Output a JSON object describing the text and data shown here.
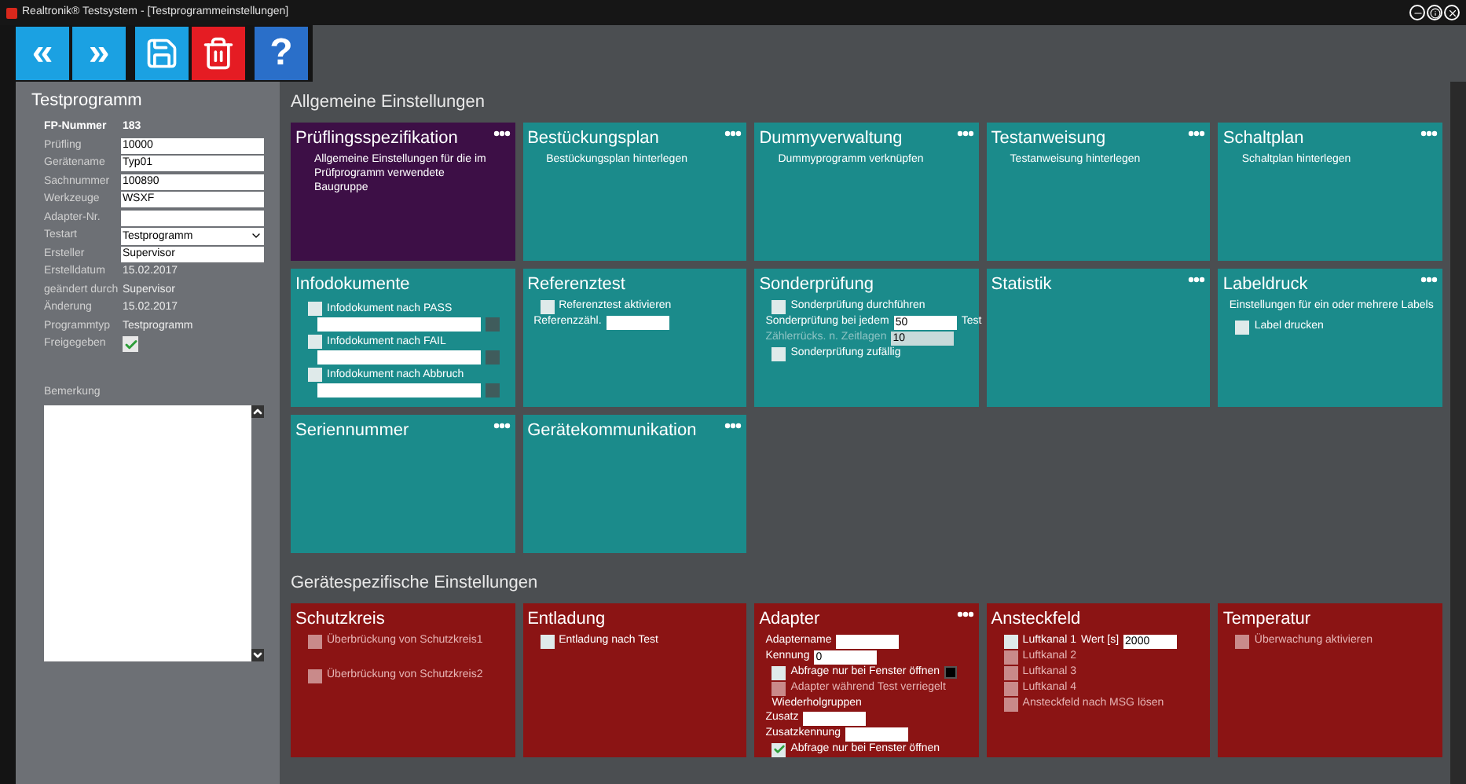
{
  "window": {
    "title": "Realtronik® Testsystem - [Testprogrammeinstellungen]"
  },
  "toolbar": [
    {
      "kind": "glyph",
      "label": "«",
      "color": "#1ba1e2"
    },
    {
      "kind": "glyph",
      "label": "»",
      "color": "#1ba1e2"
    },
    {
      "kind": "save",
      "color": "#1ba1e2"
    },
    {
      "kind": "delete",
      "color": "#e51c23"
    },
    {
      "kind": "glyph",
      "label": "?",
      "color": "#2a6fc9"
    }
  ],
  "left_panel": {
    "title": "Testprogramm",
    "rows": [
      {
        "kind": "static",
        "label": "FP-Nummer",
        "value": "183",
        "bold": true
      },
      {
        "kind": "input",
        "label": "Prüfling",
        "value": "10000"
      },
      {
        "kind": "input",
        "label": "Gerätename",
        "value": "Typ01"
      },
      {
        "kind": "input",
        "label": "Sachnummer",
        "value": "100890"
      },
      {
        "kind": "input",
        "label": "Werkzeuge",
        "value": "WSXF"
      },
      {
        "kind": "input",
        "label": "Adapter-Nr."
      },
      {
        "kind": "select",
        "label": "Testart",
        "value": "Testprogramm"
      },
      {
        "kind": "input",
        "label": "Ersteller",
        "value": "Supervisor"
      },
      {
        "kind": "static",
        "label": "Erstelldatum",
        "value": "15.02.2017"
      },
      {
        "kind": "static",
        "label": "geändert durch",
        "value": "Supervisor"
      },
      {
        "kind": "static",
        "label": "Änderung",
        "value": "15.02.2017"
      },
      {
        "kind": "static",
        "label": "Programmtyp",
        "value": "Testprogramm"
      },
      {
        "kind": "checkbox",
        "label": "Freigegeben",
        "checked": true
      }
    ],
    "remark_label": "Bemerkung"
  },
  "sections": [
    {
      "title": "Allgemeine Einstellungen",
      "tiles": [
        {
          "title": "Prüflingsspezifikation",
          "color": "#3d0f46",
          "menu": true,
          "items": [
            {
              "kind": "text",
              "text": "Allgemeine Einstellungen für die im Prüfprogramm verwendete Baugruppe"
            }
          ]
        },
        {
          "title": "Bestückungsplan",
          "color": "#1b8b8b",
          "menu": true,
          "items": [
            {
              "kind": "text",
              "text": "Bestückungsplan hinterlegen"
            }
          ]
        },
        {
          "title": "Dummyverwaltung",
          "color": "#1b8b8b",
          "menu": true,
          "items": [
            {
              "kind": "text",
              "text": "Dummyprogramm verknüpfen"
            }
          ]
        },
        {
          "title": "Testanweisung",
          "color": "#1b8b8b",
          "menu": true,
          "items": [
            {
              "kind": "text",
              "text": "Testanweisung hinterlegen"
            }
          ]
        },
        {
          "title": "Schaltplan",
          "color": "#1b8b8b",
          "menu": true,
          "items": [
            {
              "kind": "text",
              "text": "Schaltplan hinterlegen"
            }
          ]
        },
        {
          "title": "Infodokumente",
          "color": "#1b8b8b",
          "menu": false,
          "items": [
            {
              "kind": "doc",
              "label": "Infodokument nach PASS",
              "checked": false
            },
            {
              "kind": "doc",
              "label": "Infodokument nach FAIL",
              "checked": false
            },
            {
              "kind": "doc",
              "label": "Infodokument nach Abbruch",
              "checked": false
            }
          ]
        },
        {
          "title": "Referenztest",
          "color": "#1b8b8b",
          "menu": false,
          "items": [
            {
              "kind": "checkbox",
              "label": "Referenztest aktivieren",
              "checked": false,
              "disabled": false
            },
            {
              "kind": "field",
              "label": "Referenzzähl.",
              "disabled": false
            }
          ]
        },
        {
          "title": "Sonderprüfung",
          "color": "#1b8b8b",
          "menu": false,
          "items": [
            {
              "kind": "checkbox",
              "label": "Sonderprüfung durchführen",
              "checked": false,
              "disabled": false
            },
            {
              "kind": "field",
              "label": "Sonderprüfung bei jedem",
              "value": "50",
              "unit": "Test",
              "disabled": false
            },
            {
              "kind": "field",
              "label": "Zählerrücks. n. Zeitlagen",
              "value": "10",
              "disabled": true
            },
            {
              "kind": "checkbox",
              "label": "Sonderprüfung zufällig",
              "checked": false,
              "disabled": false
            }
          ]
        },
        {
          "title": "Statistik",
          "color": "#1b8b8b",
          "menu": true
        },
        {
          "title": "Labeldruck",
          "color": "#1b8b8b",
          "menu": true,
          "items": [
            {
              "kind": "note",
              "text": "Einstellungen für ein oder mehrere Labels"
            },
            {
              "kind": "checkbox",
              "label": "Label drucken",
              "checked": false,
              "disabled": false
            }
          ]
        },
        {
          "title": "Seriennummer",
          "color": "#1b8b8b",
          "menu": true
        },
        {
          "title": "Gerätekommunikation",
          "color": "#1b8b8b",
          "menu": true
        }
      ]
    },
    {
      "title": "Gerätespezifische Einstellungen",
      "tiles": [
        {
          "title": "Schutzkreis",
          "color": "#8b1414",
          "menu": false,
          "items": [
            {
              "kind": "checkbox",
              "label": "Überbrückung von Schutzkreis1",
              "checked": false,
              "disabled": true
            },
            {
              "kind": "gap"
            },
            {
              "kind": "checkbox",
              "label": "Überbrückung von Schutzkreis2",
              "checked": false,
              "disabled": true
            }
          ]
        },
        {
          "title": "Entladung",
          "color": "#8b1414",
          "menu": false,
          "items": [
            {
              "kind": "checkbox",
              "label": "Entladung nach Test",
              "checked": false,
              "disabled": false
            }
          ]
        },
        {
          "title": "Adapter",
          "color": "#8b1414",
          "menu": true,
          "items": [
            {
              "kind": "field",
              "label": "Adaptername",
              "disabled": false
            },
            {
              "kind": "field",
              "label": "Kennung",
              "value": "0",
              "disabled": false
            },
            {
              "kind": "checkbox",
              "label": "Abfrage nur bei Fenster öffnen",
              "checked": false,
              "disabled": false,
              "button": true
            },
            {
              "kind": "checkbox",
              "label": "Adapter während Test verriegelt",
              "checked": false,
              "disabled": true
            },
            {
              "kind": "label",
              "text": "Wiederholgruppen"
            },
            {
              "kind": "field",
              "label": "Zusatz",
              "disabled": false
            },
            {
              "kind": "field",
              "label": "Zusatzkennung",
              "disabled": false
            },
            {
              "kind": "checkbox",
              "label": "Abfrage nur bei Fenster öffnen",
              "checked": true,
              "disabled": false
            }
          ]
        },
        {
          "title": "Ansteckfeld",
          "color": "#8b1414",
          "menu": false,
          "items": [
            {
              "kind": "checkbox",
              "label": "Luftkanal 1",
              "checked": false,
              "disabled": false,
              "field_label": "Wert [s]",
              "value": "2000"
            },
            {
              "kind": "checkbox",
              "label": "Luftkanal 2",
              "checked": false,
              "disabled": true
            },
            {
              "kind": "checkbox",
              "label": "Luftkanal 3",
              "checked": false,
              "disabled": true
            },
            {
              "kind": "checkbox",
              "label": "Luftkanal 4",
              "checked": false,
              "disabled": true
            },
            {
              "kind": "checkbox",
              "label": "Ansteckfeld nach MSG lösen",
              "checked": false,
              "disabled": true
            }
          ]
        },
        {
          "title": "Temperatur",
          "color": "#8b1414",
          "menu": false,
          "items": [
            {
              "kind": "checkbox",
              "label": "Überwachung aktivieren",
              "checked": false,
              "disabled": true
            }
          ]
        }
      ]
    }
  ]
}
